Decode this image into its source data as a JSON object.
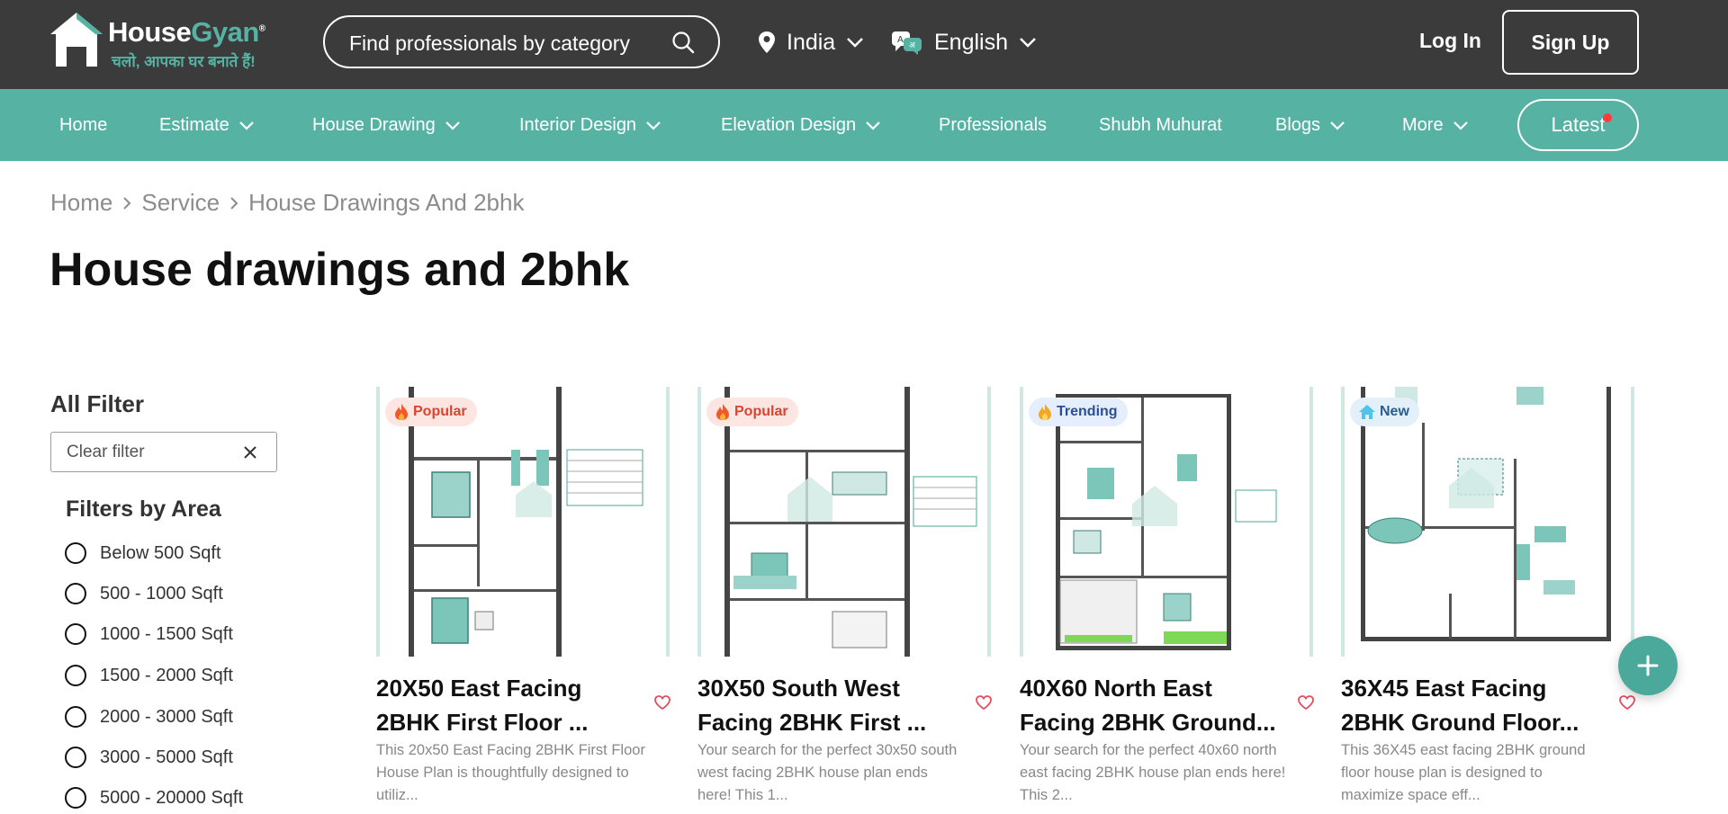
{
  "header": {
    "brand_house": "House",
    "brand_gyan": "Gyan",
    "brand_mark": "®",
    "tagline": "चलो, आपका घर बनाते हैं!",
    "search_placeholder": "Find professionals by category",
    "location": "India",
    "language": "English",
    "login": "Log In",
    "signup": "Sign Up"
  },
  "nav": {
    "items": [
      {
        "label": "Home",
        "dropdown": false
      },
      {
        "label": "Estimate",
        "dropdown": true
      },
      {
        "label": "House Drawing",
        "dropdown": true
      },
      {
        "label": "Interior Design",
        "dropdown": true
      },
      {
        "label": "Elevation Design",
        "dropdown": true
      },
      {
        "label": "Professionals",
        "dropdown": false
      },
      {
        "label": "Shubh Muhurat",
        "dropdown": false
      },
      {
        "label": "Blogs",
        "dropdown": true
      },
      {
        "label": "More",
        "dropdown": true
      }
    ],
    "latest": "Latest"
  },
  "breadcrumb": [
    "Home",
    "Service",
    "House Drawings And 2bhk"
  ],
  "page_title": "House drawings and 2bhk",
  "filters": {
    "heading": "All Filter",
    "clear_label": "Clear filter",
    "area_heading": "Filters by Area",
    "area_options": [
      "Below 500 Sqft",
      "500 - 1000 Sqft",
      "1000 - 1500 Sqft",
      "1500 - 2000 Sqft",
      "2000 - 3000 Sqft",
      "3000 - 5000 Sqft",
      "5000 - 20000 Sqft"
    ]
  },
  "cards": [
    {
      "badge": "Popular",
      "badge_type": "popular",
      "title_line1": "20X50 East Facing",
      "title_line2": "2BHK First Floor ...",
      "desc_line1": "This 20x50 East Facing 2BHK First Floor",
      "desc_line2": "House Plan is thoughtfully designed to",
      "desc_line3": "utiliz..."
    },
    {
      "badge": "Popular",
      "badge_type": "popular",
      "title_line1": "30X50 South West",
      "title_line2": "Facing 2BHK First ...",
      "desc_line1": "Your search for the perfect 30x50 south",
      "desc_line2": "west facing 2BHK house plan ends",
      "desc_line3": "here! This 1..."
    },
    {
      "badge": "Trending",
      "badge_type": "trending",
      "title_line1": "40X60 North East",
      "title_line2": "Facing 2BHK Ground...",
      "desc_line1": "Your search for the perfect 40x60 north",
      "desc_line2": "east facing 2BHK house plan ends here!",
      "desc_line3": "This 2..."
    },
    {
      "badge": "New",
      "badge_type": "new",
      "title_line1": "36X45 East Facing",
      "title_line2": "2BHK Ground Floor...",
      "desc_line1": "This 36X45 east facing 2BHK ground",
      "desc_line2": "floor house plan is designed to",
      "desc_line3": "maximize space eff..."
    }
  ],
  "colors": {
    "header_bg": "#3b3b3b",
    "nav_bg": "#56b3a4",
    "accent": "#56b3a4",
    "fab": "#4aa99a"
  }
}
